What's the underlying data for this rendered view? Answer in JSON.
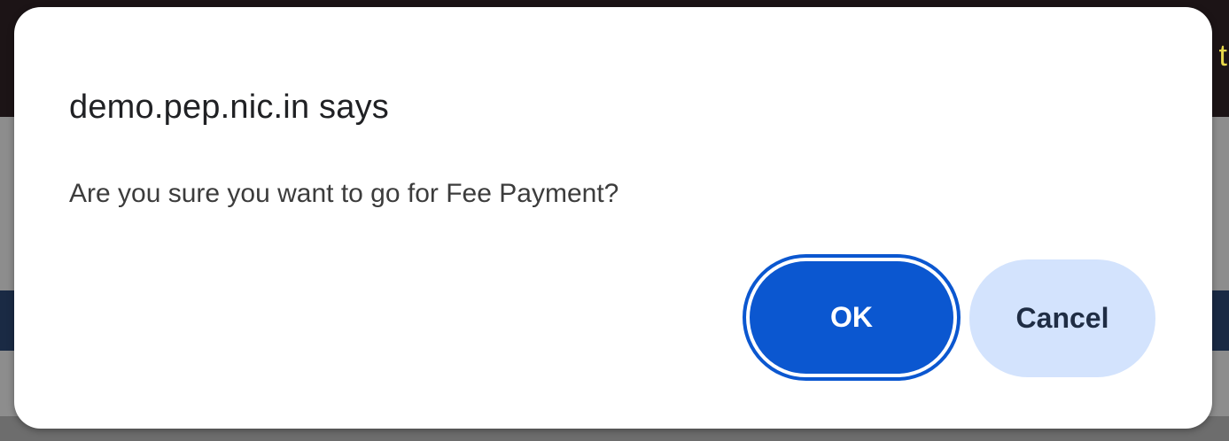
{
  "background": {
    "peek_text": "t"
  },
  "dialog": {
    "title": "demo.pep.nic.in says",
    "message": "Are you sure you want to go for Fee Payment?",
    "ok_label": "OK",
    "cancel_label": "Cancel"
  },
  "colors": {
    "ok_button": "#0b57d0",
    "cancel_button": "#d3e3fd",
    "dialog_background": "#ffffff"
  }
}
